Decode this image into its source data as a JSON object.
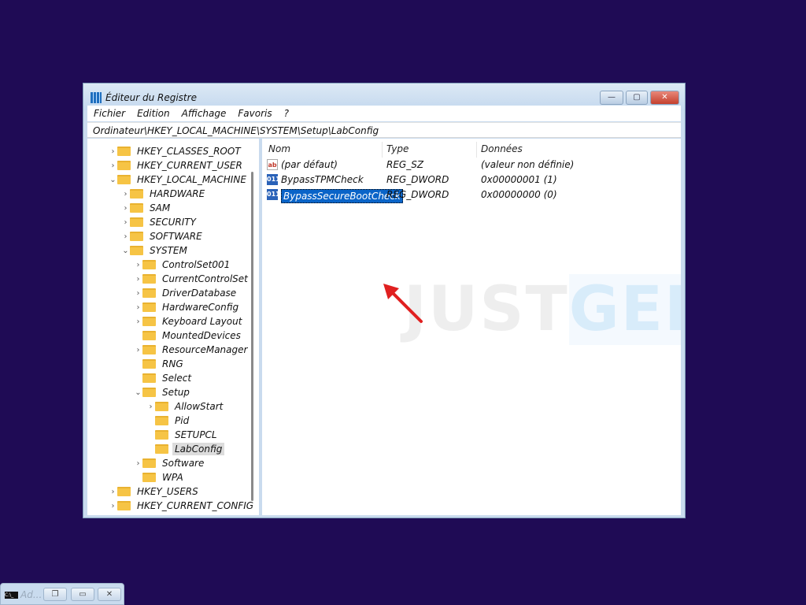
{
  "window": {
    "title": "Éditeur du Registre",
    "minimize": "—",
    "maximize": "▢",
    "close": "✕"
  },
  "menu": [
    "Fichier",
    "Edition",
    "Affichage",
    "Favoris",
    "?"
  ],
  "path": "Ordinateur\\HKEY_LOCAL_MACHINE\\SYSTEM\\Setup\\LabConfig",
  "tree": [
    {
      "label": "HKEY_CLASSES_ROOT",
      "level": 0,
      "state": "collapsed"
    },
    {
      "label": "HKEY_CURRENT_USER",
      "level": 0,
      "state": "collapsed"
    },
    {
      "label": "HKEY_LOCAL_MACHINE",
      "level": 0,
      "state": "expanded"
    },
    {
      "label": "HARDWARE",
      "level": 1,
      "state": "collapsed"
    },
    {
      "label": "SAM",
      "level": 1,
      "state": "collapsed"
    },
    {
      "label": "SECURITY",
      "level": 1,
      "state": "collapsed"
    },
    {
      "label": "SOFTWARE",
      "level": 1,
      "state": "collapsed"
    },
    {
      "label": "SYSTEM",
      "level": 1,
      "state": "expanded"
    },
    {
      "label": "ControlSet001",
      "level": 2,
      "state": "collapsed"
    },
    {
      "label": "CurrentControlSet",
      "level": 2,
      "state": "collapsed"
    },
    {
      "label": "DriverDatabase",
      "level": 2,
      "state": "collapsed"
    },
    {
      "label": "HardwareConfig",
      "level": 2,
      "state": "collapsed"
    },
    {
      "label": "Keyboard Layout",
      "level": 2,
      "state": "collapsed"
    },
    {
      "label": "MountedDevices",
      "level": 2,
      "state": "leaf"
    },
    {
      "label": "ResourceManager",
      "level": 2,
      "state": "collapsed"
    },
    {
      "label": "RNG",
      "level": 2,
      "state": "leaf"
    },
    {
      "label": "Select",
      "level": 2,
      "state": "leaf"
    },
    {
      "label": "Setup",
      "level": 2,
      "state": "expanded"
    },
    {
      "label": "AllowStart",
      "level": 3,
      "state": "collapsed"
    },
    {
      "label": "Pid",
      "level": 3,
      "state": "leaf"
    },
    {
      "label": "SETUPCL",
      "level": 3,
      "state": "leaf"
    },
    {
      "label": "LabConfig",
      "level": 3,
      "state": "leaf",
      "selected": true
    },
    {
      "label": "Software",
      "level": 2,
      "state": "collapsed"
    },
    {
      "label": "WPA",
      "level": 2,
      "state": "leaf"
    },
    {
      "label": "HKEY_USERS",
      "level": 0,
      "state": "collapsed"
    },
    {
      "label": "HKEY_CURRENT_CONFIG",
      "level": 0,
      "state": "collapsed"
    }
  ],
  "columns": {
    "name": "Nom",
    "type": "Type",
    "data": "Données"
  },
  "values": [
    {
      "icon": "string-value-icon",
      "icon_text": "ab",
      "name": "(par défaut)",
      "type": "REG_SZ",
      "data": "(valeur non définie)"
    },
    {
      "icon": "dword-value-icon",
      "icon_text": "011",
      "name": "BypassTPMCheck",
      "type": "REG_DWORD",
      "data": "0x00000001 (1)"
    },
    {
      "icon": "dword-value-icon",
      "icon_text": "011",
      "name": "BypassSecureBootCheck",
      "type": "REG_DWORD",
      "data": "0x00000000 (0)",
      "selected": true
    }
  ],
  "watermark": {
    "part1": "JUST",
    "part2": "GEEK"
  },
  "taskbar": {
    "cmd_icon": "C:\\_",
    "label": "Ad...",
    "restore": "❐",
    "maximize": "▭",
    "close": "✕"
  },
  "colors": {
    "desktop": "#1f0b55",
    "selection": "#0a64c8",
    "arrow": "#e02020"
  }
}
